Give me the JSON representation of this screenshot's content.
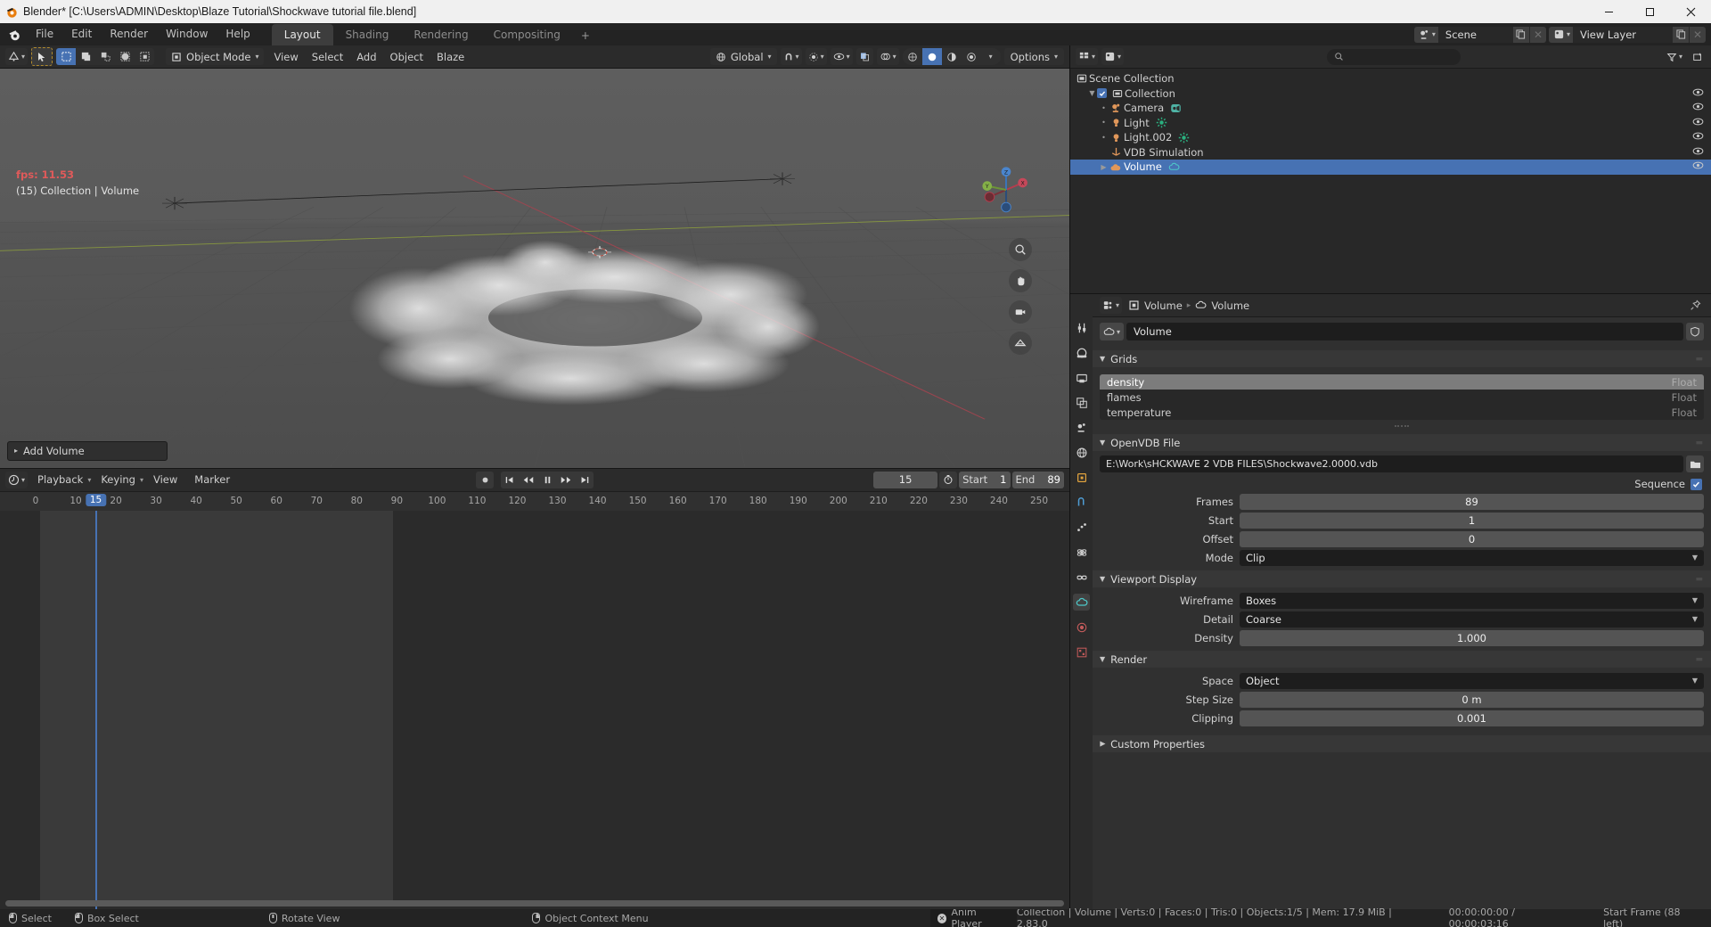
{
  "window": {
    "title": "Blender* [C:\\Users\\ADMIN\\Desktop\\Blaze Tutorial\\Shockwave tutorial file.blend]",
    "minimize": "–",
    "maximize": "❐",
    "close": "✕"
  },
  "topbar": {
    "menus": [
      "File",
      "Edit",
      "Render",
      "Window",
      "Help"
    ],
    "workspaces": [
      {
        "label": "Layout",
        "active": true
      },
      {
        "label": "Shading",
        "active": false
      },
      {
        "label": "Rendering",
        "active": false
      },
      {
        "label": "Compositing",
        "active": false
      }
    ],
    "add_workspace": "+",
    "scene_name": "Scene",
    "view_layer_name": "View Layer"
  },
  "viewport_header": {
    "editor_type": "editor-type-3dview",
    "mode": "Object Mode",
    "menus": [
      "View",
      "Select",
      "Add",
      "Object",
      "Blaze"
    ],
    "transform_orientation": "Global",
    "options_label": "Options"
  },
  "viewport": {
    "fps": "fps: 11.53",
    "collection_info": "(15) Collection | Volume",
    "add_volume_label": "Add Volume",
    "gizmo_axes": [
      "X",
      "Y",
      "Z"
    ]
  },
  "outliner": {
    "search_placeholder": "",
    "root": "Scene Collection",
    "items": [
      {
        "label": "Collection",
        "indent": 1,
        "icon": "collection-icon",
        "checkbox": true,
        "disclosure": "down",
        "selected": false,
        "extra": ""
      },
      {
        "label": "Camera",
        "indent": 2,
        "icon": "camera-icon",
        "checkbox": false,
        "disclosure": "dot",
        "selected": false,
        "extra": "camera-data-icon"
      },
      {
        "label": "Light",
        "indent": 2,
        "icon": "light-icon",
        "checkbox": false,
        "disclosure": "dot",
        "selected": false,
        "extra": "light-data-icon"
      },
      {
        "label": "Light.002",
        "indent": 2,
        "icon": "light-icon",
        "checkbox": false,
        "disclosure": "dot",
        "selected": false,
        "extra": "light-data-icon"
      },
      {
        "label": "VDB Simulation",
        "indent": 2,
        "icon": "empty-axes-icon",
        "checkbox": false,
        "disclosure": "none",
        "selected": false,
        "extra": ""
      },
      {
        "label": "Volume",
        "indent": 2,
        "icon": "volume-object-icon",
        "checkbox": false,
        "disclosure": "right",
        "selected": true,
        "extra": "volume-data-icon"
      }
    ]
  },
  "properties": {
    "breadcrumb": [
      "Volume",
      "Volume"
    ],
    "datablock_name": "Volume",
    "panels": {
      "grids": {
        "title": "Grids",
        "rows": [
          {
            "name": "density",
            "type": "Float",
            "selected": true
          },
          {
            "name": "flames",
            "type": "Float",
            "selected": false
          },
          {
            "name": "temperature",
            "type": "Float",
            "selected": false
          }
        ]
      },
      "openvdb": {
        "title": "OpenVDB File",
        "filepath": "E:\\Work\\sHCKWAVE 2 VDB FILES\\Shockwave2.0000.vdb",
        "sequence_label": "Sequence",
        "sequence_checked": true,
        "fields": [
          {
            "label": "Frames",
            "value": "89",
            "kind": "number"
          },
          {
            "label": "Start",
            "value": "1",
            "kind": "number"
          },
          {
            "label": "Offset",
            "value": "0",
            "kind": "number"
          },
          {
            "label": "Mode",
            "value": "Clip",
            "kind": "enum"
          }
        ]
      },
      "viewport_display": {
        "title": "Viewport Display",
        "fields": [
          {
            "label": "Wireframe",
            "value": "Boxes",
            "kind": "enum"
          },
          {
            "label": "Detail",
            "value": "Coarse",
            "kind": "enum"
          },
          {
            "label": "Density",
            "value": "1.000",
            "kind": "number"
          }
        ]
      },
      "render": {
        "title": "Render",
        "fields": [
          {
            "label": "Space",
            "value": "Object",
            "kind": "enum"
          },
          {
            "label": "Step Size",
            "value": "0 m",
            "kind": "number"
          },
          {
            "label": "Clipping",
            "value": "0.001",
            "kind": "number"
          }
        ]
      },
      "custom_properties": {
        "title": "Custom Properties"
      }
    }
  },
  "timeline": {
    "menus": [
      "Playback",
      "Keying",
      "View",
      "Marker"
    ],
    "current_frame": "15",
    "start_label": "Start",
    "start_value": "1",
    "end_label": "End",
    "end_value": "89",
    "ticks": [
      "0",
      "10",
      "20",
      "30",
      "40",
      "50",
      "60",
      "70",
      "80",
      "90",
      "100",
      "110",
      "120",
      "130",
      "140",
      "150",
      "160",
      "170",
      "180",
      "190",
      "200",
      "210",
      "220",
      "230",
      "240",
      "250"
    ],
    "playhead_frame": "15"
  },
  "statusbar": {
    "hints": [
      {
        "icon": "mouse-left-icon",
        "label": "Select"
      },
      {
        "icon": "mouse-left-icon",
        "label": "Box Select"
      },
      {
        "icon": "mouse-middle-icon",
        "label": "Rotate View"
      },
      {
        "icon": "mouse-right-icon",
        "label": "Object Context Menu"
      }
    ],
    "anim_player": "Anim Player",
    "scene_stats": "Collection | Volume | Verts:0 | Faces:0 | Tris:0 | Objects:1/5 | Mem: 17.9 MiB | 2.83.0",
    "timecode": "00:00:00:00 / 00:00:03:16",
    "frame_info": "Start Frame (88 left)"
  },
  "colors": {
    "accent": "#4772b3",
    "header": "#2b2b2b",
    "panel": "#303030",
    "fps_red": "#e05a5a"
  }
}
